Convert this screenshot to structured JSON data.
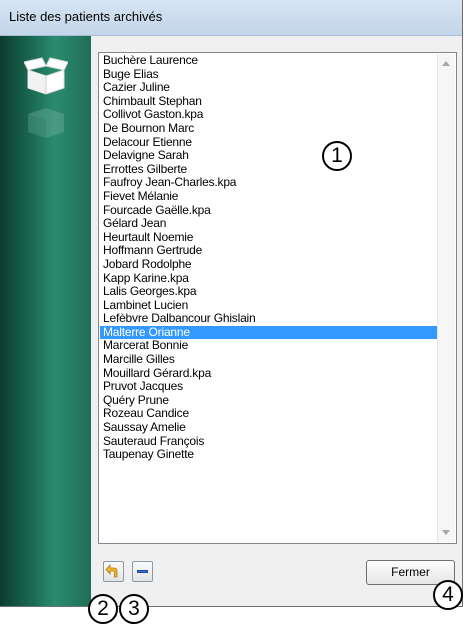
{
  "window": {
    "title": "Liste des patients archivés"
  },
  "icons": {
    "sidebar_top": "open-box-icon",
    "sidebar_bottom": "faded-box-icon",
    "restore": "undo-arrow-icon",
    "remove": "minus-icon"
  },
  "patients": [
    "Buchère Laurence",
    "Buge Elias",
    "Cazier Juline",
    "Chimbault Stephan",
    "Collivot Gaston.kpa",
    "De Bournon Marc",
    "Delacour Etienne",
    "Delavigne Sarah",
    "Errottes Gilberte",
    "Faufroy Jean-Charles.kpa",
    "Fievet Mélanie",
    "Fourcade Gaëlle.kpa",
    "Gélard Jean",
    "Heurtault Noemie",
    "Hoffmann Gertrude",
    "Jobard Rodolphe",
    "Kapp Karine.kpa",
    "Lalis Georges.kpa",
    "Lambinet Lucien",
    "Lefèbvre Dalbancour Ghislain",
    "Malterre Orianne",
    "Marcerat Bonnie",
    "Marcille Gilles",
    "Mouillard Gérard.kpa",
    "Pruvot Jacques",
    "Quéry Prune",
    "Rozeau Candice",
    "Saussay Amelie",
    "Sauteraud François",
    "Taupenay Ginette"
  ],
  "selected_patient": "Malterre Orianne",
  "buttons": {
    "close_label": "Fermer"
  },
  "callouts": {
    "one": "1",
    "two": "2",
    "three": "3",
    "four": "4"
  },
  "colors": {
    "selection": "#3399ff",
    "sidebar": "#1a6a52"
  }
}
